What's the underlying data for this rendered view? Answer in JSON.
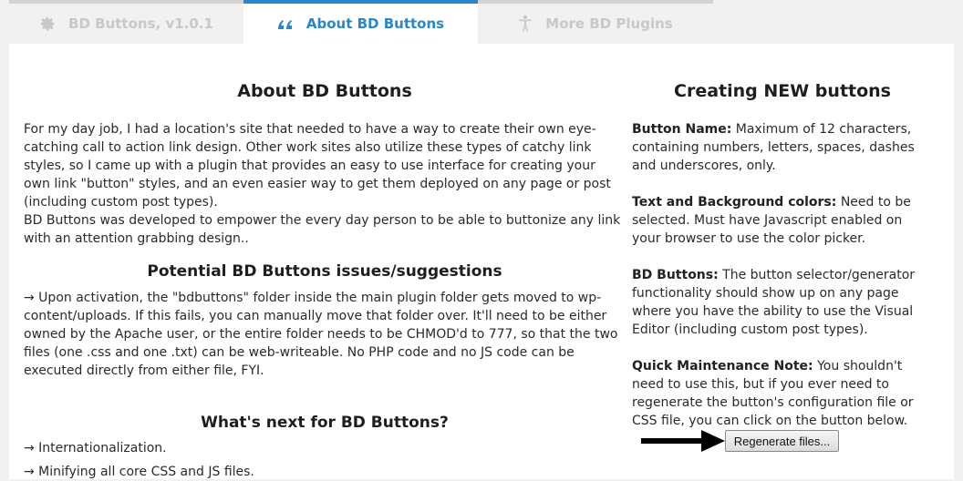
{
  "tabs": [
    {
      "label": "BD Buttons, v1.0.1",
      "icon": "gear-icon",
      "active": false
    },
    {
      "label": "About BD Buttons",
      "icon": "quote-icon",
      "active": true
    },
    {
      "label": "More BD Plugins",
      "icon": "person-icon",
      "active": false
    }
  ],
  "about": {
    "title": "About BD Buttons",
    "para1": "For my day job, I had a location's site that needed to have a way to create their own eye-catching call to action link design. Other work sites also utilize these types of catchy link styles, so I came up with a plugin that provides an easy to use interface for creating your own link \"button\" styles, and an even easier way to get them deployed on any page or post (including custom post types).",
    "para2": "BD Buttons was developed to empower the every day person to be able to buttonize any link with an attention grabbing design.."
  },
  "issues": {
    "title": "Potential BD Buttons issues/suggestions",
    "text": "→ Upon activation, the \"bdbuttons\" folder inside the main plugin folder gets moved to wp-content/uploads. If this fails, you can manually move that folder over. It'll need to be either owned by the Apache user, or the entire folder needs to be CHMOD'd to 777, so that the two files (one .css and one .txt) can be web-writeable. No PHP code and no JS code can be executed directly from either file, FYI."
  },
  "next": {
    "title": "What's next for BD Buttons?",
    "items": [
      "→ Internationalization.",
      "→ Minifying all core CSS and JS files."
    ]
  },
  "creating": {
    "title": "Creating NEW buttons",
    "name_label": "Button Name:",
    "name_text": " Maximum of 12 characters, containing numbers, letters, spaces, dashes and underscores, only.",
    "colors_label": "Text and Background colors:",
    "colors_text": " Need to be selected. Must have Javascript enabled on your browser to use the color picker.",
    "bd_label": "BD Buttons:",
    "bd_text": " The button selector/generator functionality should show up on any page where you have the ability to use the Visual Editor (including custom post types).",
    "maint_label": "Quick Maintenance Note:",
    "maint_text": " You shouldn't need to use this, but if you ever need to regenerate the button's configuration file or CSS file, you can click on the button below.",
    "regen_button": "Regenerate files..."
  },
  "colors": {
    "accent": "#2a86c8",
    "inactive_tab": "#c8c8c8"
  }
}
